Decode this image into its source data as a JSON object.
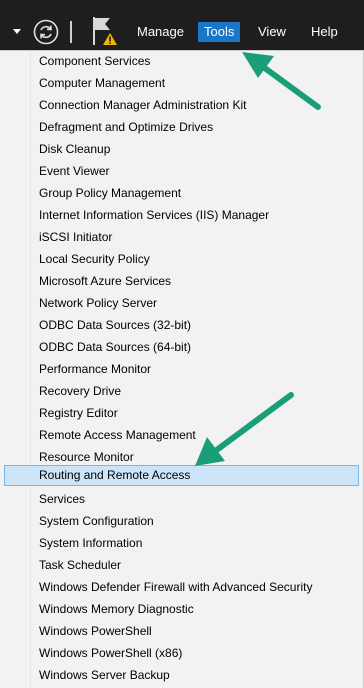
{
  "menubar": {
    "items": [
      "Manage",
      "Tools",
      "View",
      "Help"
    ],
    "active": "Tools"
  },
  "tools_menu": {
    "items": [
      "Component Services",
      "Computer Management",
      "Connection Manager Administration Kit",
      "Defragment and Optimize Drives",
      "Disk Cleanup",
      "Event Viewer",
      "Group Policy Management",
      "Internet Information Services (IIS) Manager",
      "iSCSI Initiator",
      "Local Security Policy",
      "Microsoft Azure Services",
      "Network Policy Server",
      "ODBC Data Sources (32-bit)",
      "ODBC Data Sources (64-bit)",
      "Performance Monitor",
      "Recovery Drive",
      "Registry Editor",
      "Remote Access Management",
      "Resource Monitor",
      "Routing and Remote Access",
      "Services",
      "System Configuration",
      "System Information",
      "Task Scheduler",
      "Windows Defender Firewall with Advanced Security",
      "Windows Memory Diagnostic",
      "Windows PowerShell",
      "Windows PowerShell (x86)",
      "Windows Server Backup"
    ],
    "highlighted_index": 19
  },
  "colors": {
    "menubar_bg": "#1e1e1e",
    "active_menu_bg": "#1976c8",
    "dropdown_bg": "#f2f2f2",
    "highlight_bg": "#cce4f7",
    "annotation_arrow": "#1a9e77"
  }
}
